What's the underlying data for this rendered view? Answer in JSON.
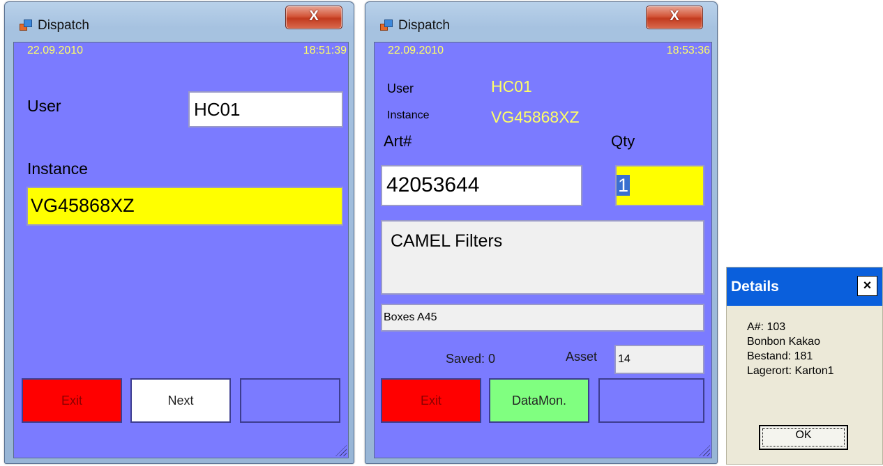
{
  "window1": {
    "title": "Dispatch",
    "close": "X",
    "date": "22.09.2010",
    "time": "18:51:39",
    "user_label": "User",
    "user_value": "HC01",
    "instance_label": "Instance",
    "instance_value": "VG45868XZ",
    "buttons": {
      "exit": "Exit",
      "next": "Next",
      "third": ""
    }
  },
  "window2": {
    "title": "Dispatch",
    "close": "X",
    "date": "22.09.2010",
    "time": "18:53:36",
    "user_label": "User",
    "user_value": "HC01",
    "instance_label": "Instance",
    "instance_value": "VG45868XZ",
    "art_label": "Art#",
    "art_value": "42053644",
    "qty_label": "Qty",
    "qty_value": "1",
    "description": "CAMEL Filters",
    "location": "Boxes A45",
    "saved_text": "Saved: 0",
    "asset_label": "Asset",
    "asset_value": "14",
    "buttons": {
      "exit": "Exit",
      "datamon": "DataMon.",
      "third": ""
    }
  },
  "details": {
    "title": "Details",
    "close": "×",
    "lines": [
      "A#: 103",
      "Bonbon Kakao",
      "Bestand: 181",
      "Lagerort: Karton1"
    ],
    "ok": "OK"
  },
  "colors": {
    "client_bg": "#7b7bff",
    "accent_text": "#ffff66",
    "exit_button": "#ff0000",
    "datamon_button": "#80ff80",
    "highlight_field": "#ffff00",
    "dialog_title": "#0a5fdc"
  },
  "icons": [
    "app-icon",
    "close-icon",
    "resize-grip-icon"
  ]
}
